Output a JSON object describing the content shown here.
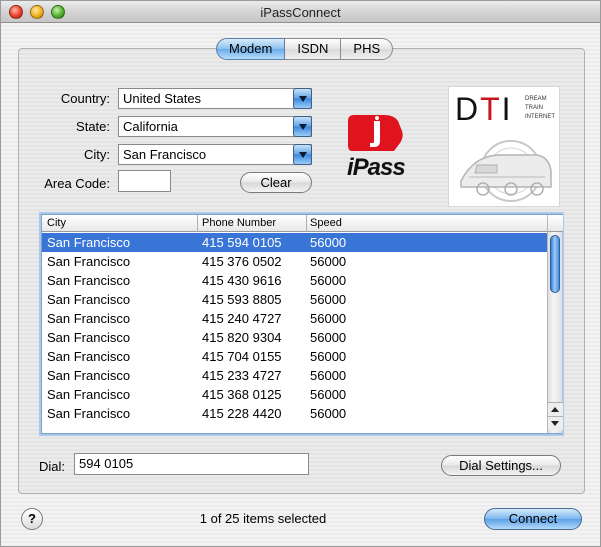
{
  "window": {
    "title": "iPassConnect"
  },
  "tabs": [
    {
      "label": "Modem",
      "active": true
    },
    {
      "label": "ISDN",
      "active": false
    },
    {
      "label": "PHS",
      "active": false
    }
  ],
  "form": {
    "country_label": "Country:",
    "country_value": "United States",
    "state_label": "State:",
    "state_value": "California",
    "city_label": "City:",
    "city_value": "San Francisco",
    "area_code_label": "Area Code:",
    "area_code_value": "",
    "clear_label": "Clear"
  },
  "logos": {
    "ipass_text": "iPass",
    "dti_text": "DTI",
    "dti_tagline": [
      "DREAM",
      "TRAIN",
      "INTERNET"
    ],
    "ipass_color": "#e0141e",
    "dti_red": "#c8141e"
  },
  "table": {
    "columns": [
      "City",
      "Phone Number",
      "Speed"
    ],
    "rows": [
      {
        "city": "San Francisco",
        "phone": "415 594 0105",
        "speed": "56000",
        "selected": true
      },
      {
        "city": "San Francisco",
        "phone": "415 376 0502",
        "speed": "56000",
        "selected": false
      },
      {
        "city": "San Francisco",
        "phone": "415 430 9616",
        "speed": "56000",
        "selected": false
      },
      {
        "city": "San Francisco",
        "phone": "415 593 8805",
        "speed": "56000",
        "selected": false
      },
      {
        "city": "San Francisco",
        "phone": "415 240 4727",
        "speed": "56000",
        "selected": false
      },
      {
        "city": "San Francisco",
        "phone": "415 820 9304",
        "speed": "56000",
        "selected": false
      },
      {
        "city": "San Francisco",
        "phone": "415 704 0155",
        "speed": "56000",
        "selected": false
      },
      {
        "city": "San Francisco",
        "phone": "415 233 4727",
        "speed": "56000",
        "selected": false
      },
      {
        "city": "San Francisco",
        "phone": "415 368 0125",
        "speed": "56000",
        "selected": false
      },
      {
        "city": "San Francisco",
        "phone": "415 228 4420",
        "speed": "56000",
        "selected": false
      }
    ],
    "selection_color": "#3875d7"
  },
  "dial": {
    "label": "Dial:",
    "value": "594 0105",
    "settings_label": "Dial Settings..."
  },
  "footer": {
    "help_label": "?",
    "status": "1 of 25 items selected",
    "connect_label": "Connect"
  }
}
